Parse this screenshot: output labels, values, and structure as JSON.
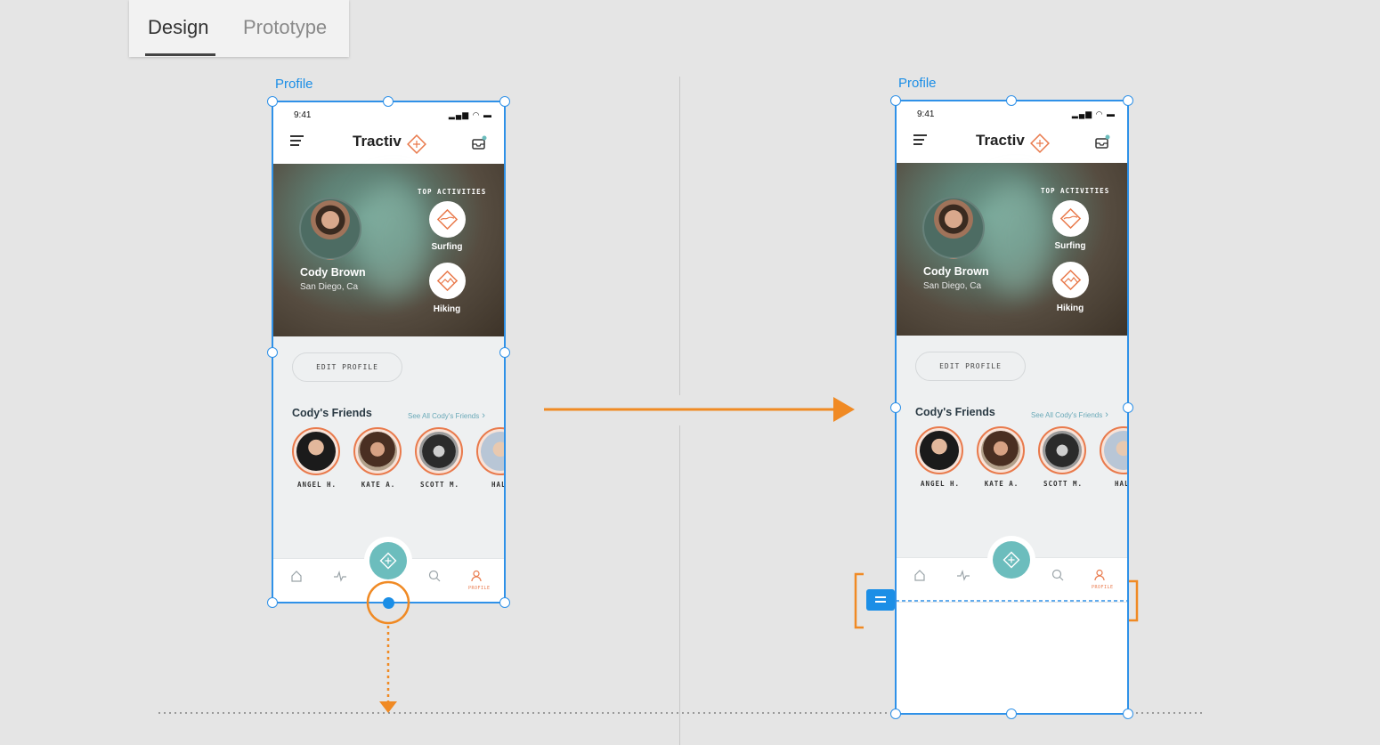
{
  "tabs": {
    "design": "Design",
    "prototype": "Prototype"
  },
  "artboard": {
    "label": "Profile",
    "status_time": "9:41",
    "status_icons": "▂▄▆ ◠ ▬",
    "brand": "Tractiv",
    "user_name": "Cody Brown",
    "user_location": "San Diego, Ca",
    "top_activities_label": "TOP ACTIVITIES",
    "activities": [
      {
        "label": "Surfing"
      },
      {
        "label": "Hiking"
      }
    ],
    "edit_profile": "EDIT PROFILE",
    "friends_title": "Cody's Friends",
    "see_all": "See All Cody's Friends",
    "friends": [
      "ANGEL H.",
      "KATE A.",
      "SCOTT M.",
      "HALE"
    ],
    "profile_tab_label": "PROFILE"
  },
  "colors": {
    "selection": "#2f91e8",
    "annotation": "#f08a24",
    "accent": "#e97a4c",
    "fab": "#6cbdbd"
  }
}
